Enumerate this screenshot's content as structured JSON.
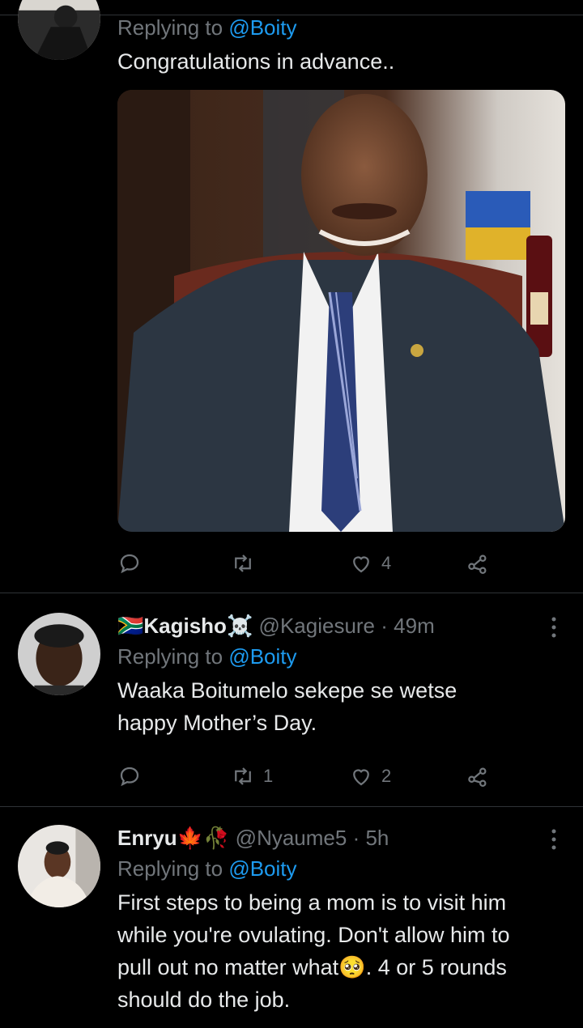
{
  "tweet1": {
    "reply_prefix": "Replying to ",
    "reply_to": "@Boity",
    "text": "Congratulations in advance..",
    "likes": "4"
  },
  "tweet2": {
    "name": "🇿🇦Kagisho☠️",
    "handle": "@Kagiesure",
    "time": "· 49m",
    "reply_prefix": "Replying to ",
    "reply_to": "@Boity",
    "text_line1": "Waaka Boitumelo sekepe se wetse",
    "text_line2": "happy Mother’s Day.",
    "retweets": "1",
    "likes": "2"
  },
  "tweet3": {
    "name": "Enryu🍁🥀",
    "handle": "@Nyaume5",
    "time": "· 5h",
    "reply_prefix": "Replying to ",
    "reply_to": "@Boity",
    "text_line1": "First steps to being a mom is to visit him",
    "text_line2": "while you're ovulating. Don't allow him to",
    "text_line3": "pull out no matter what🥺. 4 or 5 rounds",
    "text_line4": "should do the job."
  },
  "icons": [
    "reply-icon",
    "retweet-icon",
    "like-icon",
    "share-icon",
    "more-icon"
  ],
  "colors": {
    "background": "#000000",
    "text": "#e7e9ea",
    "muted": "#71767b",
    "link": "#1d9bf0",
    "divider": "#2f3336"
  }
}
